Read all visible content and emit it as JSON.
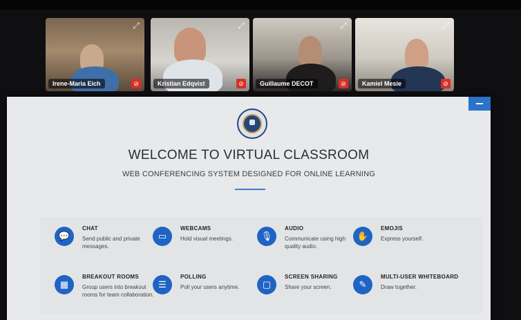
{
  "participants": [
    {
      "name": "Irene-Maria Eich"
    },
    {
      "name": "Kristian Edqvist"
    },
    {
      "name": "Guillaume DECOT"
    },
    {
      "name": "Kamiel Mesie"
    }
  ],
  "icons": {
    "expand": "expand-icon",
    "mic": "mic-muted-icon"
  },
  "welcome": {
    "title": "WELCOME TO VIRTUAL CLASSROOM",
    "subtitle": "WEB CONFERENCING SYSTEM DESIGNED FOR ONLINE LEARNING"
  },
  "features": [
    {
      "title": "CHAT",
      "description": "Send public and private messages.",
      "icon": "chat-icon"
    },
    {
      "title": "WEBCAMS",
      "description": "Hold visual meetings.",
      "icon": "webcam-icon"
    },
    {
      "title": "AUDIO",
      "description": "Communicate using high quality audio.",
      "icon": "microphone-icon"
    },
    {
      "title": "EMOJIS",
      "description": "Express yourself.",
      "icon": "emoji-hand-icon"
    },
    {
      "title": "BREAKOUT ROOMS",
      "description": "Group users into breakout rooms for team collaboration.",
      "icon": "breakout-icon"
    },
    {
      "title": "POLLING",
      "description": "Poll your users anytime.",
      "icon": "poll-icon"
    },
    {
      "title": "SCREEN SHARING",
      "description": "Share your screen.",
      "icon": "screen-share-icon"
    },
    {
      "title": "MULTI-USER WHITEBOARD",
      "description": "Draw together.",
      "icon": "whiteboard-icon"
    }
  ],
  "colors": {
    "accent": "#1f64c4",
    "panel": "#e7e9eb",
    "background": "#0f0f11"
  }
}
